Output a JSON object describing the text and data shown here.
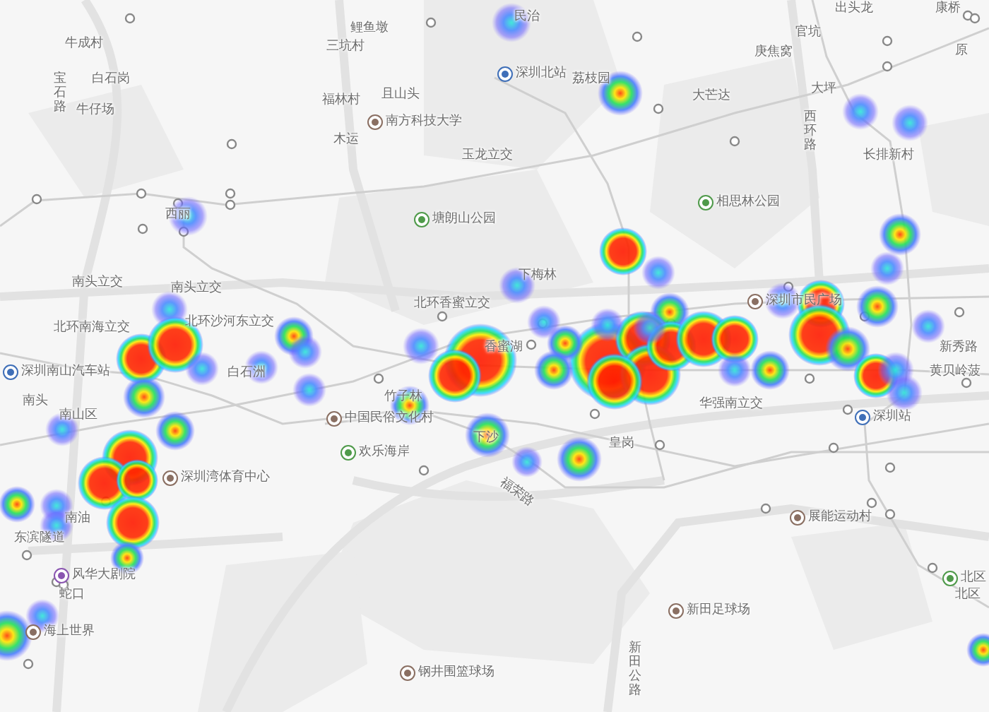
{
  "map": {
    "labels": [
      {
        "text": "鲤鱼墩",
        "kind": "plain"
      },
      {
        "text": "民治",
        "kind": "plain"
      },
      {
        "text": "出头龙",
        "kind": "plain"
      },
      {
        "text": "康桥",
        "kind": "plain"
      },
      {
        "text": "牛成村",
        "kind": "plain"
      },
      {
        "text": "三坑村",
        "kind": "plain"
      },
      {
        "text": "深圳北站",
        "kind": "station"
      },
      {
        "text": "荔枝园",
        "kind": "plain"
      },
      {
        "text": "官坑",
        "kind": "plain"
      },
      {
        "text": "庚焦窝",
        "kind": "plain"
      },
      {
        "text": "原",
        "kind": "plain"
      },
      {
        "text": "宝石路",
        "kind": "vertical"
      },
      {
        "text": "白石岗",
        "kind": "plain"
      },
      {
        "text": "福林村",
        "kind": "plain"
      },
      {
        "text": "且山头",
        "kind": "plain"
      },
      {
        "text": "大芒达",
        "kind": "plain"
      },
      {
        "text": "大坪",
        "kind": "plain"
      },
      {
        "text": "西环路",
        "kind": "vertical"
      },
      {
        "text": "牛仔场",
        "kind": "plain"
      },
      {
        "text": "南方科技大学",
        "kind": "venue"
      },
      {
        "text": "木运",
        "kind": "plain"
      },
      {
        "text": "玉龙立交",
        "kind": "plain"
      },
      {
        "text": "长排新村",
        "kind": "plain"
      },
      {
        "text": "相思林公园",
        "kind": "park"
      },
      {
        "text": "西丽",
        "kind": "plain"
      },
      {
        "text": "塘朗山公园",
        "kind": "park"
      },
      {
        "text": "下梅林",
        "kind": "plain"
      },
      {
        "text": "南头立交",
        "kind": "plain"
      },
      {
        "text": "南头立交",
        "kind": "plain"
      },
      {
        "text": "北环南海立交",
        "kind": "plain"
      },
      {
        "text": "北环沙河东立交",
        "kind": "plain"
      },
      {
        "text": "北环香蜜立交",
        "kind": "plain"
      },
      {
        "text": "深圳市民广场",
        "kind": "venue"
      },
      {
        "text": "香蜜湖",
        "kind": "plain"
      },
      {
        "text": "深圳南山汽车站",
        "kind": "bus"
      },
      {
        "text": "白石洲",
        "kind": "plain"
      },
      {
        "text": "南头",
        "kind": "plain"
      },
      {
        "text": "南山区",
        "kind": "plain"
      },
      {
        "text": "竹子林",
        "kind": "plain"
      },
      {
        "text": "中国民俗文化村",
        "kind": "venue"
      },
      {
        "text": "欢乐海岸",
        "kind": "park"
      },
      {
        "text": "下沙",
        "kind": "plain"
      },
      {
        "text": "皇岗",
        "kind": "plain"
      },
      {
        "text": "福荣路",
        "kind": "rotated"
      },
      {
        "text": "华强南立交",
        "kind": "plain"
      },
      {
        "text": "深圳站",
        "kind": "station"
      },
      {
        "text": "新秀路",
        "kind": "plain"
      },
      {
        "text": "黄贝岭菠",
        "kind": "plain"
      },
      {
        "text": "深圳湾体育中心",
        "kind": "venue"
      },
      {
        "text": "南油",
        "kind": "plain"
      },
      {
        "text": "东滨隧道",
        "kind": "plain"
      },
      {
        "text": "风华大剧院",
        "kind": "music"
      },
      {
        "text": "蛇口",
        "kind": "plain"
      },
      {
        "text": "海上世界",
        "kind": "venue"
      },
      {
        "text": "展能运动村",
        "kind": "venue"
      },
      {
        "text": "北区",
        "kind": "park"
      },
      {
        "text": "北区",
        "kind": "plain"
      },
      {
        "text": "新田足球场",
        "kind": "venue"
      },
      {
        "text": "新田公路",
        "kind": "vertical"
      },
      {
        "text": "钢井围篮球场",
        "kind": "venue"
      }
    ]
  }
}
